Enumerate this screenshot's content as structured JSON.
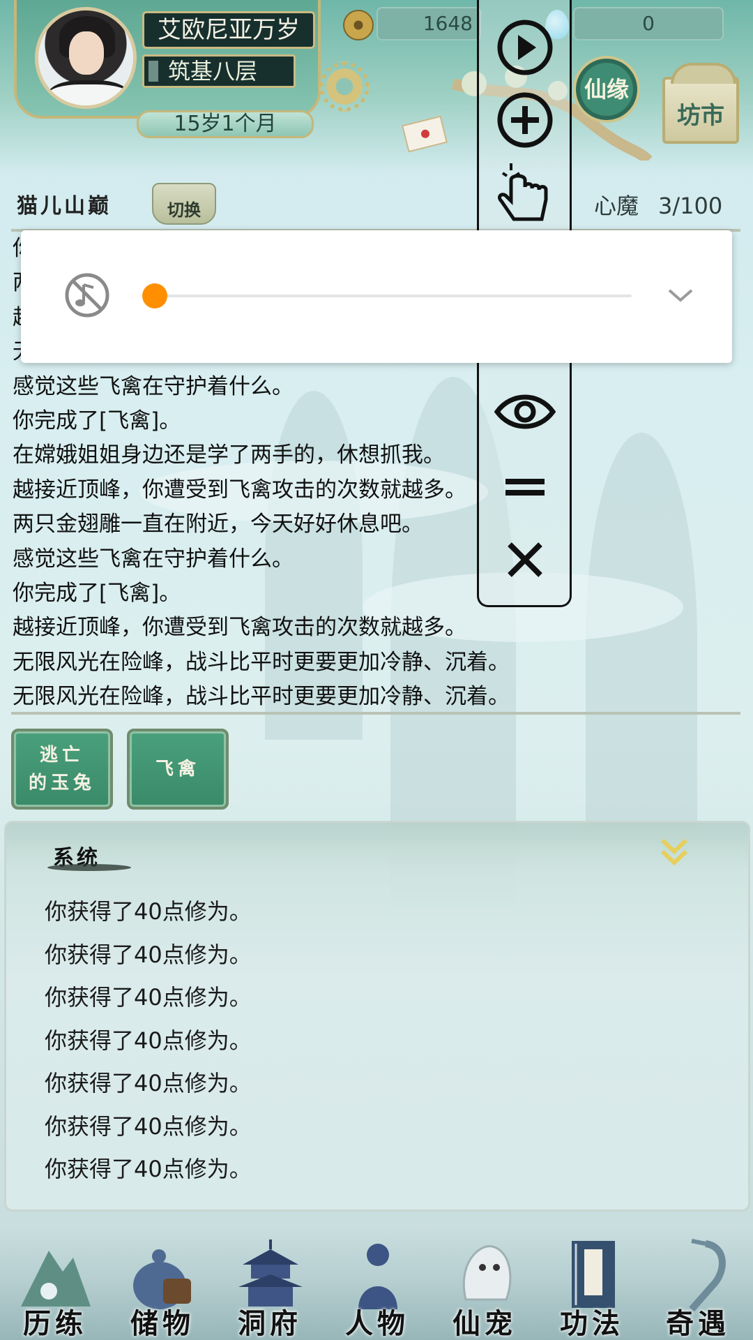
{
  "player": {
    "name": "艾欧尼亚万岁",
    "level": "筑基八层",
    "age": "15岁1个月"
  },
  "currency": {
    "coins": "1648",
    "gems": "0"
  },
  "header_buttons": {
    "xianyuan": "仙缘",
    "fangshi": "坊市"
  },
  "location": {
    "name": "猫儿山巅",
    "switch_label": "切换"
  },
  "xinmo": {
    "label": "心魔",
    "value": "3/100"
  },
  "log": {
    "lines": [
      "你",
      "两",
      "越",
      "无",
      "感觉这些飞禽在守护着什么。",
      "你完成了[飞禽]。",
      "在嫦娥姐姐身边还是学了两手的，休想抓我。",
      "越接近顶峰，你遭受到飞禽攻击的次数就越多。",
      "两只金翅雕一直在附近，今天好好休息吧。",
      "感觉这些飞禽在守护着什么。",
      "你完成了[飞禽]。",
      "越接近顶峰，你遭受到飞禽攻击的次数就越多。",
      "无限风光在险峰，战斗比平时更要更加冷静、沉着。",
      "无限风光在险峰，战斗比平时更要更加冷静、沉着。"
    ]
  },
  "events": {
    "btn1": "逃亡的玉兔",
    "btn2": "飞禽"
  },
  "system": {
    "title": "系统",
    "lines": [
      "你获得了40点修为。",
      "你获得了40点修为。",
      "你获得了40点修为。",
      "你获得了40点修为。",
      "你获得了40点修为。",
      "你获得了40点修为。",
      "你获得了40点修为。"
    ]
  },
  "nav": {
    "items": [
      "历练",
      "储物",
      "洞府",
      "人物",
      "仙宠",
      "功法",
      "奇遇"
    ]
  },
  "toolbar": {
    "icons": [
      "play-icon",
      "plus-icon",
      "tap-hand-icon",
      "eye-icon",
      "equals-icon",
      "close-icon"
    ]
  },
  "volume": {
    "level": 0,
    "muted": true,
    "accent": "#ff8f00"
  },
  "colors": {
    "jade": "#3a8a68",
    "gold_border": "#c5b77a",
    "dark_label": "#17302e"
  }
}
